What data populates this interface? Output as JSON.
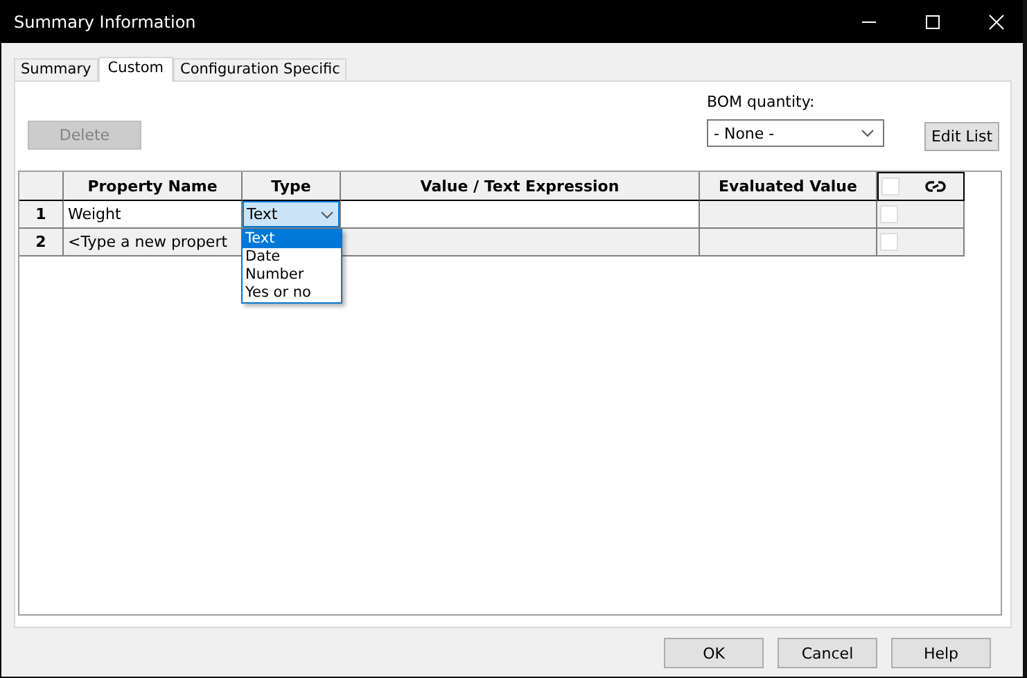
{
  "window": {
    "title": "Summary Information"
  },
  "tabs": [
    {
      "label": "Summary",
      "selected": false
    },
    {
      "label": "Custom",
      "selected": true
    },
    {
      "label": "Configuration Specific",
      "selected": false
    }
  ],
  "delete_button": {
    "label": "Delete",
    "disabled": true
  },
  "bom_quantity": {
    "label": "BOM quantity:",
    "value": "- None -"
  },
  "edit_list_button": {
    "label": "Edit List"
  },
  "table": {
    "columns": [
      "Property Name",
      "Type",
      "Value / Text Expression",
      "Evaluated Value"
    ],
    "header_checked": false,
    "rows": [
      {
        "number": "1",
        "name": "Weight",
        "type": "Text",
        "editing": true,
        "checked": false
      },
      {
        "number": "2",
        "name": "<Type a new propert",
        "editing": false,
        "checked": false
      }
    ]
  },
  "type_dropdown": {
    "options": [
      {
        "label": "Text",
        "selected": true
      },
      {
        "label": "Date",
        "selected": false
      },
      {
        "label": "Number",
        "selected": false
      },
      {
        "label": "Yes or no",
        "selected": false
      }
    ]
  },
  "buttons": [
    {
      "label": "OK"
    },
    {
      "label": "Cancel"
    },
    {
      "label": "Help"
    }
  ]
}
